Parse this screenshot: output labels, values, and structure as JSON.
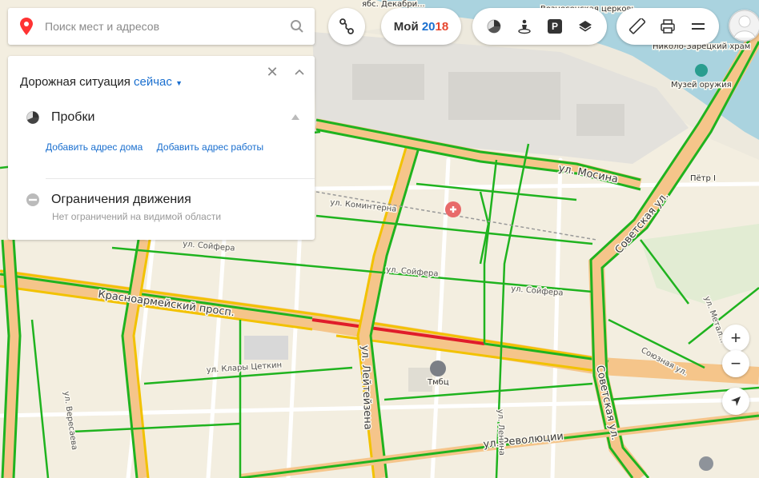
{
  "search": {
    "placeholder": "Поиск мест и адресов"
  },
  "traffic_panel": {
    "title": "Дорожная ситуация",
    "time_mode": "сейчас",
    "traffic_label": "Пробки",
    "add_home_label": "Добавить адрес дома",
    "add_work_label": "Добавить адрес работы",
    "restrictions_label": "Ограничения движения",
    "restrictions_status": "Нет ограничений на видимой области"
  },
  "toolbar": {
    "brand_text": "Мой",
    "brand_year_a": "20",
    "brand_year_b": "18",
    "parking_label": "P"
  },
  "zoom": {
    "in_label": "+",
    "out_label": "−"
  },
  "map": {
    "streets": {
      "krasnoarm": "Красноармейский просп.",
      "sovetskaya_1": "Советская ул.",
      "sovetskaya_2": "Советская ул.",
      "mosina": "ул. Мосина",
      "kominterna": "ул. Коминтерна",
      "soyfera_1": "ул. Сойфера",
      "soyfera_2": "ул. Сойфера",
      "soyfera_3": "ул. Сойфера",
      "leytey": "ул. Лейтейзена",
      "klara": "ул. Клары Цеткин",
      "revolucii": "ул. Революции",
      "lenina": "ул. Ленина",
      "veresaeva": "ул. Вересаева",
      "soyuznaya": "Союзная ул.",
      "metall": "ул. Метал..."
    },
    "pois": {
      "church": "Вознесенская церковь",
      "church2": "Николо-Зарецкий храм",
      "museum": "Музей оружия",
      "peter": "Пётр I",
      "tmbc": "Тмбц",
      "top_cut": "ябс. Декабри..."
    }
  },
  "colors": {
    "traffic_free": "#1fb31f",
    "traffic_jam": "#e01c2a",
    "traffic_slow": "#f2c200",
    "major_road": "#f5c58a",
    "water": "#aad3df",
    "accent": "#1a6fcf"
  }
}
